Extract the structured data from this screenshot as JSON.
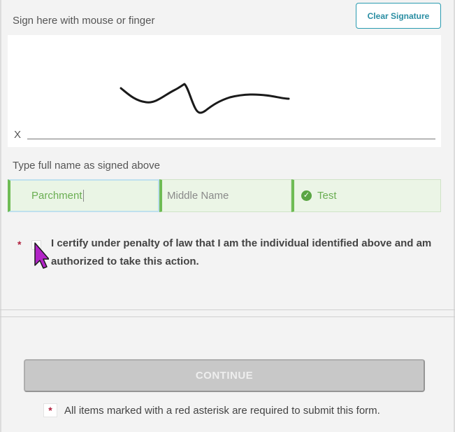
{
  "signature": {
    "instruction": "Sign here with mouse or finger",
    "clear_label": "Clear Signature",
    "x_mark": "X"
  },
  "name": {
    "label": "Type full name as signed above",
    "first": "Parchment",
    "middle_placeholder": "Middle Name",
    "last": "Test",
    "last_status_icon": "check-circle-icon"
  },
  "certify": {
    "required_mark": "*",
    "text": "I certify under penalty of law that I am the individual identified above and am authorized to take this action.",
    "checked": false
  },
  "actions": {
    "continue_label": "CONTINUE",
    "continue_enabled": false
  },
  "footer": {
    "required_mark": "*",
    "note": "All items marked with a red asterisk are required to submit this form."
  },
  "colors": {
    "accent": "#2a9bb0",
    "valid_green": "#6fbc55",
    "required_red": "#b0203e",
    "disabled_button": "#c8c8c8"
  }
}
